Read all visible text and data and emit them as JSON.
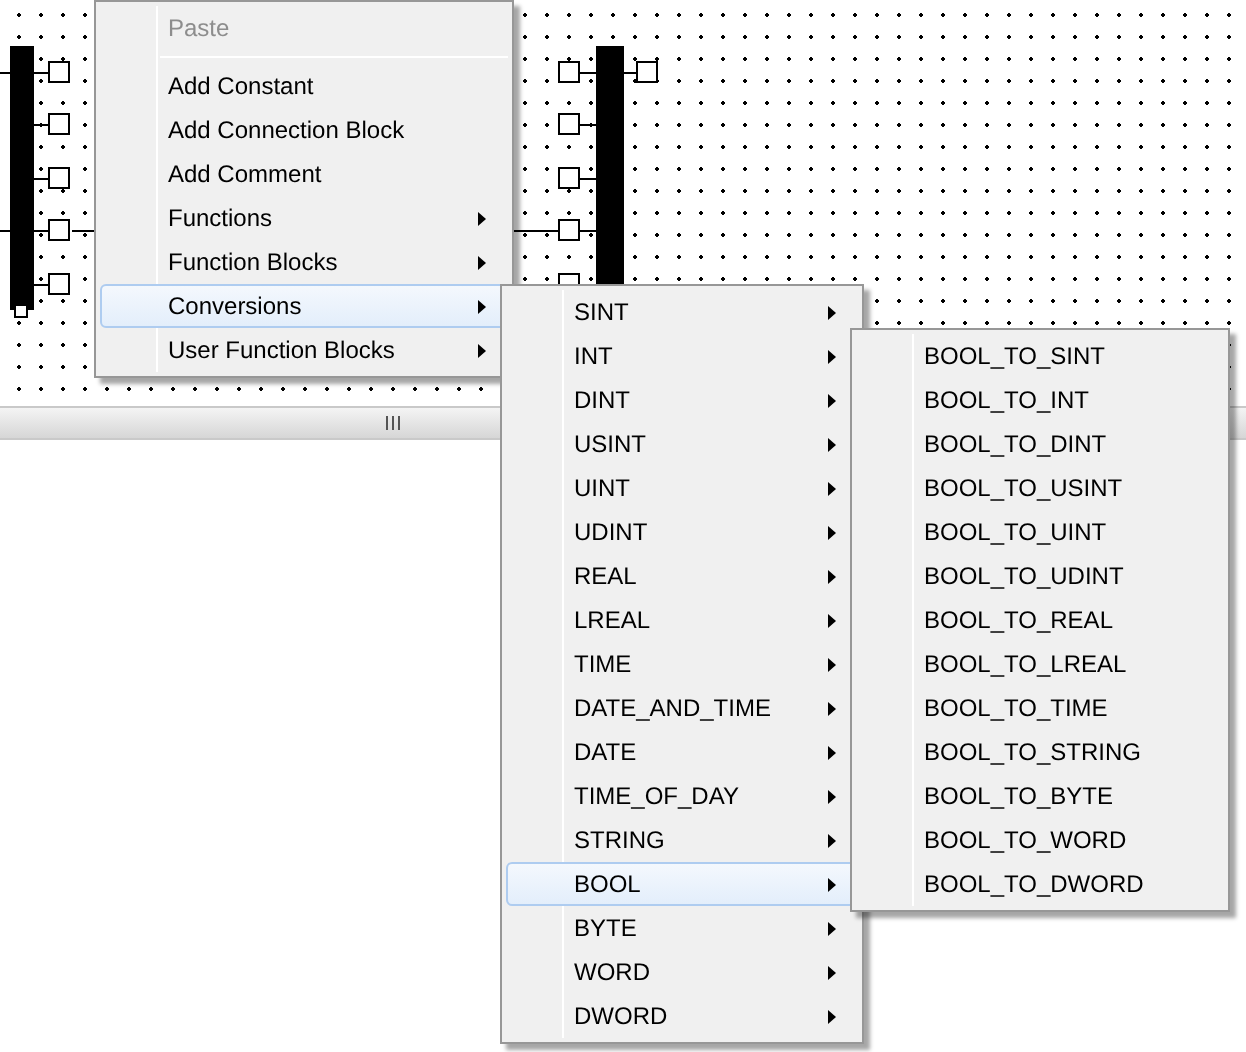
{
  "menus": [
    {
      "items": [
        {
          "kind": "command",
          "label": "Paste",
          "disabled": true,
          "selected": false
        },
        {
          "kind": "separator"
        },
        {
          "kind": "command",
          "label": "Add Constant",
          "disabled": false,
          "selected": false
        },
        {
          "kind": "command",
          "label": "Add Connection Block",
          "disabled": false,
          "selected": false
        },
        {
          "kind": "command",
          "label": "Add Comment",
          "disabled": false,
          "selected": false
        },
        {
          "kind": "submenu",
          "label": "Functions",
          "disabled": false,
          "selected": false
        },
        {
          "kind": "submenu",
          "label": "Function Blocks",
          "disabled": false,
          "selected": false
        },
        {
          "kind": "submenu",
          "label": "Conversions",
          "disabled": false,
          "selected": true
        },
        {
          "kind": "submenu",
          "label": "User Function Blocks",
          "disabled": false,
          "selected": false
        }
      ]
    },
    {
      "items": [
        {
          "kind": "submenu",
          "label": "SINT",
          "disabled": false,
          "selected": false
        },
        {
          "kind": "submenu",
          "label": "INT",
          "disabled": false,
          "selected": false
        },
        {
          "kind": "submenu",
          "label": "DINT",
          "disabled": false,
          "selected": false
        },
        {
          "kind": "submenu",
          "label": "USINT",
          "disabled": false,
          "selected": false
        },
        {
          "kind": "submenu",
          "label": "UINT",
          "disabled": false,
          "selected": false
        },
        {
          "kind": "submenu",
          "label": "UDINT",
          "disabled": false,
          "selected": false
        },
        {
          "kind": "submenu",
          "label": "REAL",
          "disabled": false,
          "selected": false
        },
        {
          "kind": "submenu",
          "label": "LREAL",
          "disabled": false,
          "selected": false
        },
        {
          "kind": "submenu",
          "label": "TIME",
          "disabled": false,
          "selected": false
        },
        {
          "kind": "submenu",
          "label": "DATE_AND_TIME",
          "disabled": false,
          "selected": false
        },
        {
          "kind": "submenu",
          "label": "DATE",
          "disabled": false,
          "selected": false
        },
        {
          "kind": "submenu",
          "label": "TIME_OF_DAY",
          "disabled": false,
          "selected": false
        },
        {
          "kind": "submenu",
          "label": "STRING",
          "disabled": false,
          "selected": false
        },
        {
          "kind": "submenu",
          "label": "BOOL",
          "disabled": false,
          "selected": true
        },
        {
          "kind": "submenu",
          "label": "BYTE",
          "disabled": false,
          "selected": false
        },
        {
          "kind": "submenu",
          "label": "WORD",
          "disabled": false,
          "selected": false
        },
        {
          "kind": "submenu",
          "label": "DWORD",
          "disabled": false,
          "selected": false
        }
      ]
    },
    {
      "items": [
        {
          "kind": "command",
          "label": "BOOL_TO_SINT",
          "disabled": false,
          "selected": false
        },
        {
          "kind": "command",
          "label": "BOOL_TO_INT",
          "disabled": false,
          "selected": false
        },
        {
          "kind": "command",
          "label": "BOOL_TO_DINT",
          "disabled": false,
          "selected": false
        },
        {
          "kind": "command",
          "label": "BOOL_TO_USINT",
          "disabled": false,
          "selected": false
        },
        {
          "kind": "command",
          "label": "BOOL_TO_UINT",
          "disabled": false,
          "selected": false
        },
        {
          "kind": "command",
          "label": "BOOL_TO_UDINT",
          "disabled": false,
          "selected": false
        },
        {
          "kind": "command",
          "label": "BOOL_TO_REAL",
          "disabled": false,
          "selected": false
        },
        {
          "kind": "command",
          "label": "BOOL_TO_LREAL",
          "disabled": false,
          "selected": false
        },
        {
          "kind": "command",
          "label": "BOOL_TO_TIME",
          "disabled": false,
          "selected": false
        },
        {
          "kind": "command",
          "label": "BOOL_TO_STRING",
          "disabled": false,
          "selected": false
        },
        {
          "kind": "command",
          "label": "BOOL_TO_BYTE",
          "disabled": false,
          "selected": false
        },
        {
          "kind": "command",
          "label": "BOOL_TO_WORD",
          "disabled": false,
          "selected": false
        },
        {
          "kind": "command",
          "label": "BOOL_TO_DWORD",
          "disabled": false,
          "selected": false
        }
      ]
    }
  ]
}
